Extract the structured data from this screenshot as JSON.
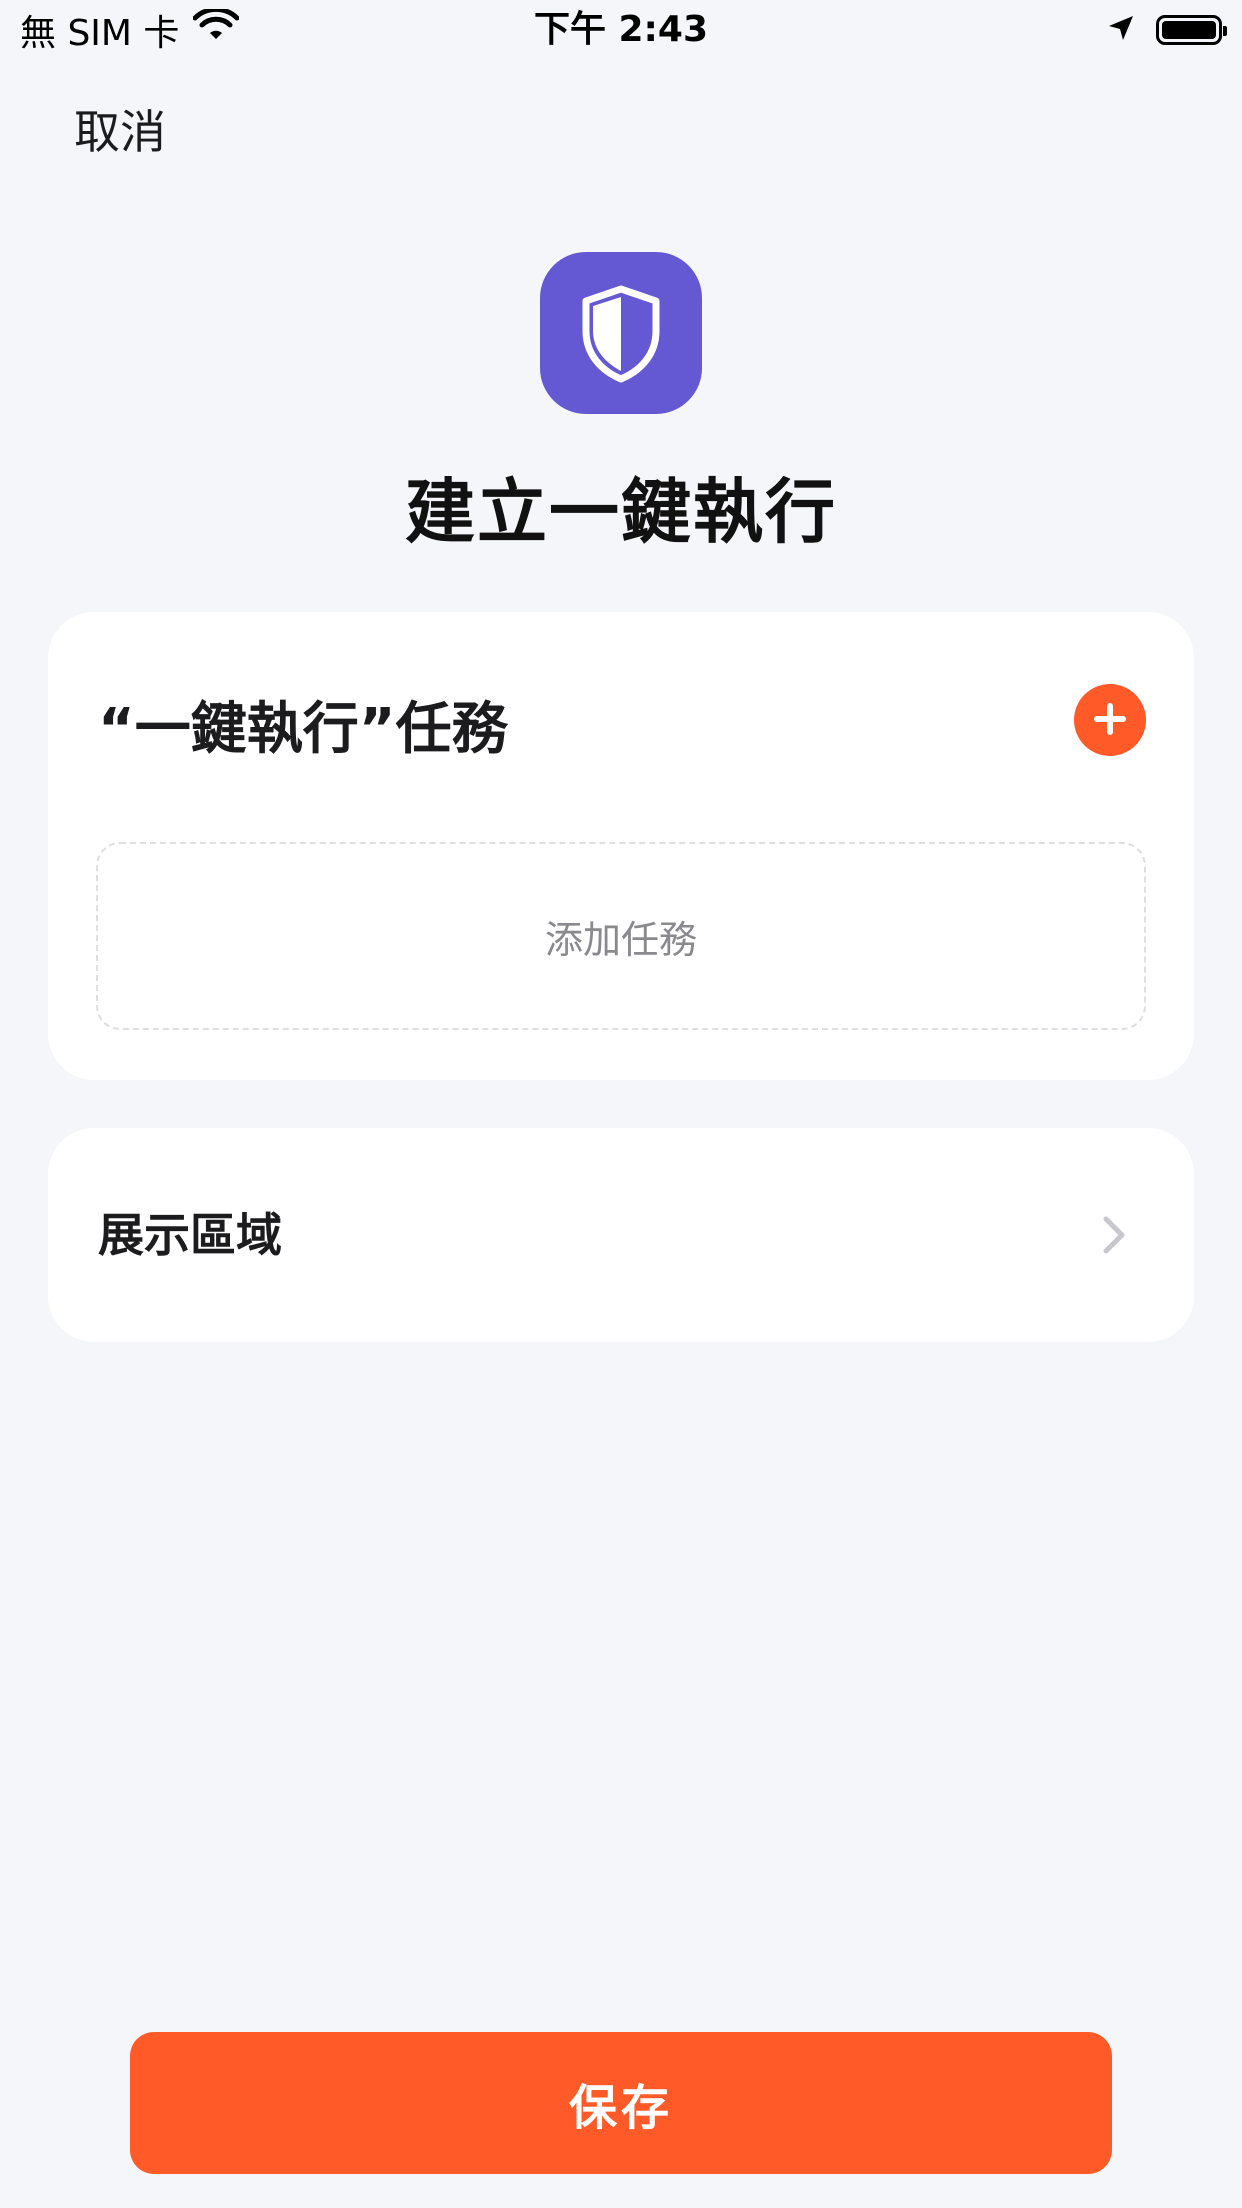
{
  "status_bar": {
    "carrier": "無 SIM 卡",
    "time": "下午 2:43",
    "icons": [
      "wifi-icon",
      "location-arrow-icon",
      "battery-icon"
    ]
  },
  "header": {
    "cancel_label": "取消"
  },
  "app_icon": {
    "icon": "shield-icon",
    "color": "#6559d3"
  },
  "page": {
    "title": "建立一鍵執行"
  },
  "tasks_card": {
    "title": "“一鍵執行”任務",
    "add_icon": "plus-circle-icon",
    "add_task_label": "添加任務"
  },
  "display_area": {
    "label": "展示區域",
    "icon": "chevron-right-icon"
  },
  "footer": {
    "save_label": "保存"
  },
  "colors": {
    "accent": "#ff5a28",
    "brand_icon": "#6559d3",
    "background": "#f5f6fa",
    "card": "#ffffff"
  }
}
